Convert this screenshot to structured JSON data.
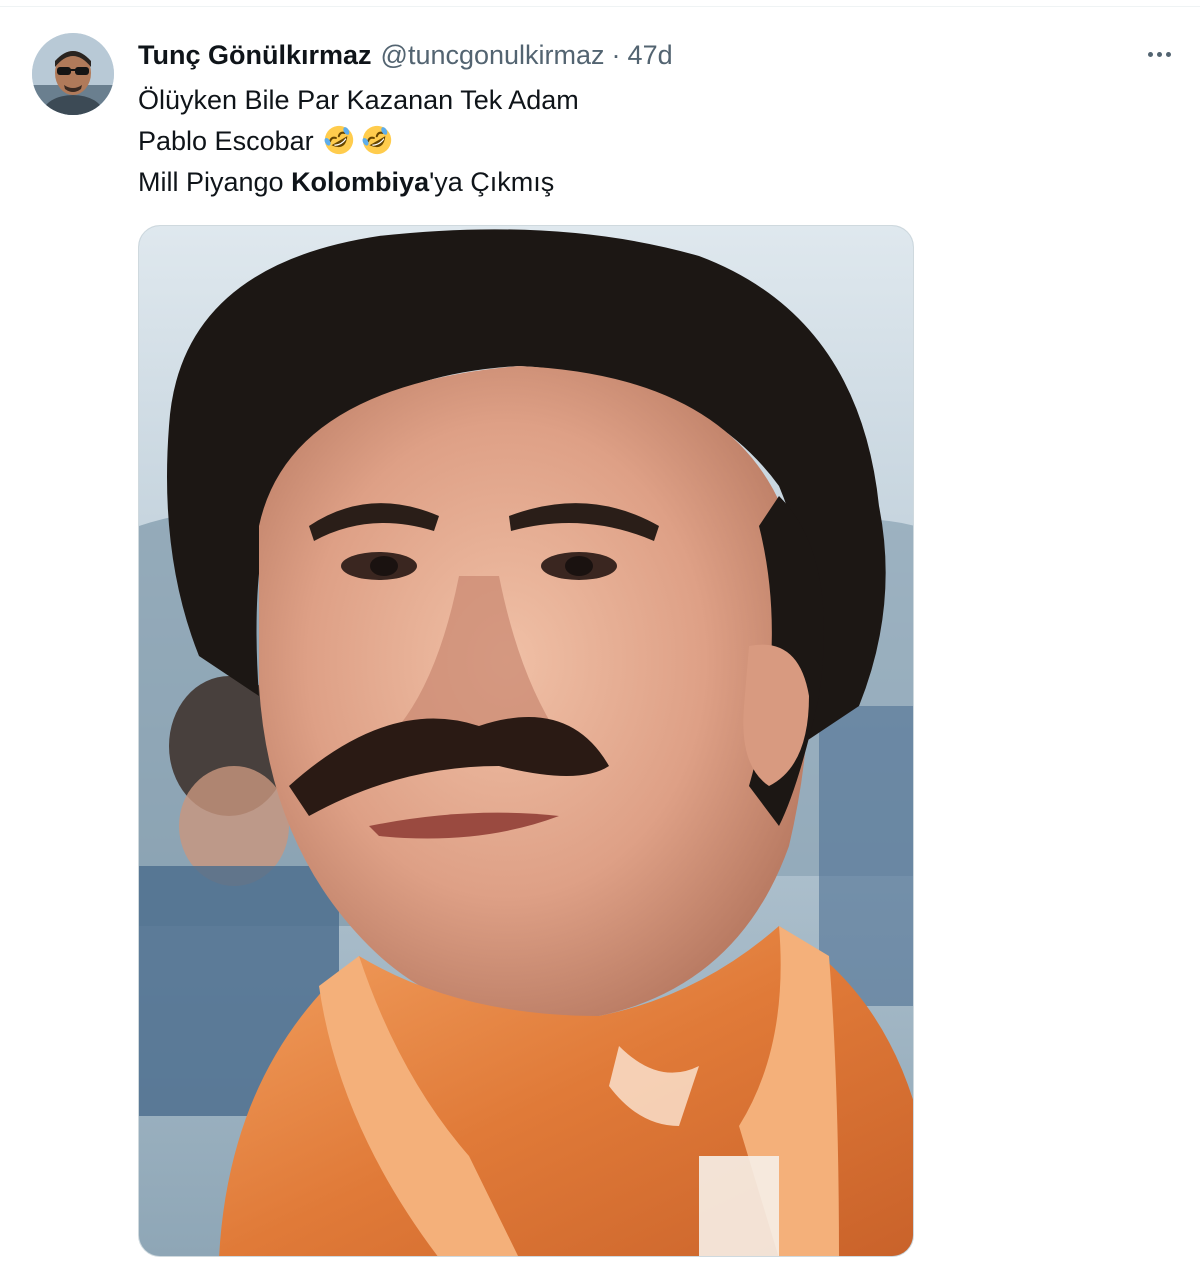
{
  "tweet": {
    "author": {
      "display_name": "Tunç Gönülkırmaz",
      "handle": "@tuncgonulkirmaz"
    },
    "separator": "·",
    "timestamp": "47d",
    "text": {
      "line1": "Ölüyken Bile Par Kazanan Tek Adam",
      "line2": "Pablo Escobar",
      "line2_emoji": "rolling-on-floor-laughing-emoji x2",
      "line3_before": "Mill Piyango ",
      "line3_bold": "Kolombiya",
      "line3_after": "'ya Çıkmış"
    },
    "icons": {
      "more": "more-options-icon"
    },
    "colors": {
      "text_primary": "#0f1419",
      "text_secondary": "#536471",
      "border": "#cfd9de"
    }
  }
}
